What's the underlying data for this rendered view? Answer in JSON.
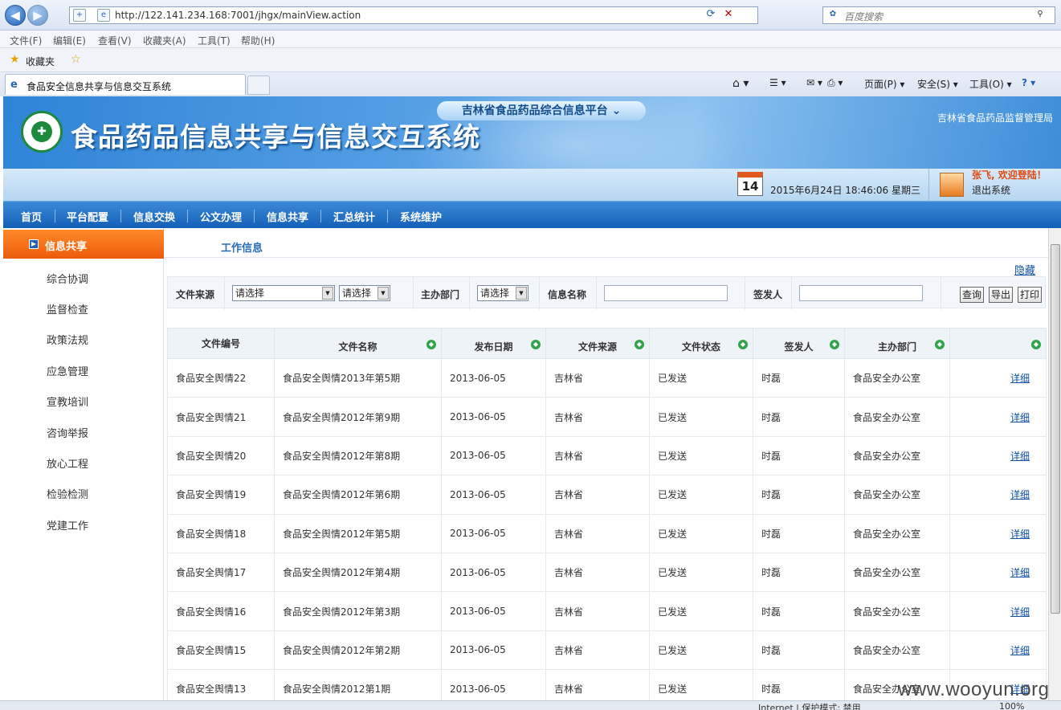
{
  "browser": {
    "url": "http://122.141.234.168:7001/jhgx/mainView.action",
    "search_placeholder": "百度搜索",
    "menu": [
      "文件(F)",
      "编辑(E)",
      "查看(V)",
      "收藏夹(A)",
      "工具(T)",
      "帮助(H)"
    ],
    "favorites_label": "收藏夹",
    "tab_title": "食品安全信息共享与信息交互系统",
    "commands": {
      "page": "页面(P) ▾",
      "safety": "安全(S) ▾",
      "tools": "工具(O) ▾",
      "help": "? ▾"
    },
    "status": "Internet | 保护模式: 禁用",
    "zoom": "100%"
  },
  "banner": {
    "system_title": "食品药品信息共享与信息交互系统",
    "platform": "吉林省食品药品综合信息平台",
    "agency": "吉林省食品药品监督管理局",
    "calendar_day": "14",
    "datetime": "2015年6月24日 18:46:06 星期三",
    "welcome": "张飞, 欢迎登陆！",
    "logout": "退出系统"
  },
  "nav": [
    "首页",
    "平台配置",
    "信息交换",
    "公文办理",
    "信息共享",
    "汇总统计",
    "系统维护"
  ],
  "sidebar": {
    "header": "信息共享",
    "items": [
      "综合协调",
      "监督检查",
      "政策法规",
      "应急管理",
      "宣教培训",
      "咨询举报",
      "放心工程",
      "检验检测",
      "党建工作"
    ]
  },
  "content": {
    "tab": "工作信息",
    "hide_link": "隐藏",
    "filter": {
      "source_label": "文件来源",
      "source_value": "请选择",
      "source_value2": "请选择",
      "dept_label": "主办部门",
      "dept_value": "请选择",
      "name_label": "信息名称",
      "signer_label": "签发人",
      "btn_query": "查询",
      "btn_export": "导出",
      "btn_print": "打印"
    },
    "columns": [
      "文件编号",
      "文件名称",
      "发布日期",
      "文件来源",
      "文件状态",
      "签发人",
      "主办部门",
      ""
    ],
    "rows": [
      [
        "食品安全舆情22",
        "食品安全舆情2013年第5期",
        "2013-06-05",
        "吉林省",
        "已发送",
        "时磊",
        "食品安全办公室",
        "详细"
      ],
      [
        "食品安全舆情21",
        "食品安全舆情2012年第9期",
        "2013-06-05",
        "吉林省",
        "已发送",
        "时磊",
        "食品安全办公室",
        "详细"
      ],
      [
        "食品安全舆情20",
        "食品安全舆情2012年第8期",
        "2013-06-05",
        "吉林省",
        "已发送",
        "时磊",
        "食品安全办公室",
        "详细"
      ],
      [
        "食品安全舆情19",
        "食品安全舆情2012年第6期",
        "2013-06-05",
        "吉林省",
        "已发送",
        "时磊",
        "食品安全办公室",
        "详细"
      ],
      [
        "食品安全舆情18",
        "食品安全舆情2012年第5期",
        "2013-06-05",
        "吉林省",
        "已发送",
        "时磊",
        "食品安全办公室",
        "详细"
      ],
      [
        "食品安全舆情17",
        "食品安全舆情2012年第4期",
        "2013-06-05",
        "吉林省",
        "已发送",
        "时磊",
        "食品安全办公室",
        "详细"
      ],
      [
        "食品安全舆情16",
        "食品安全舆情2012年第3期",
        "2013-06-05",
        "吉林省",
        "已发送",
        "时磊",
        "食品安全办公室",
        "详细"
      ],
      [
        "食品安全舆情15",
        "食品安全舆情2012年第2期",
        "2013-06-05",
        "吉林省",
        "已发送",
        "时磊",
        "食品安全办公室",
        "详细"
      ],
      [
        "食品安全舆情13",
        "食品安全舆情2012第1期",
        "2013-06-05",
        "吉林省",
        "已发送",
        "时磊",
        "食品安全办公室",
        "详细"
      ]
    ]
  },
  "watermark": "www.wooyun.org"
}
